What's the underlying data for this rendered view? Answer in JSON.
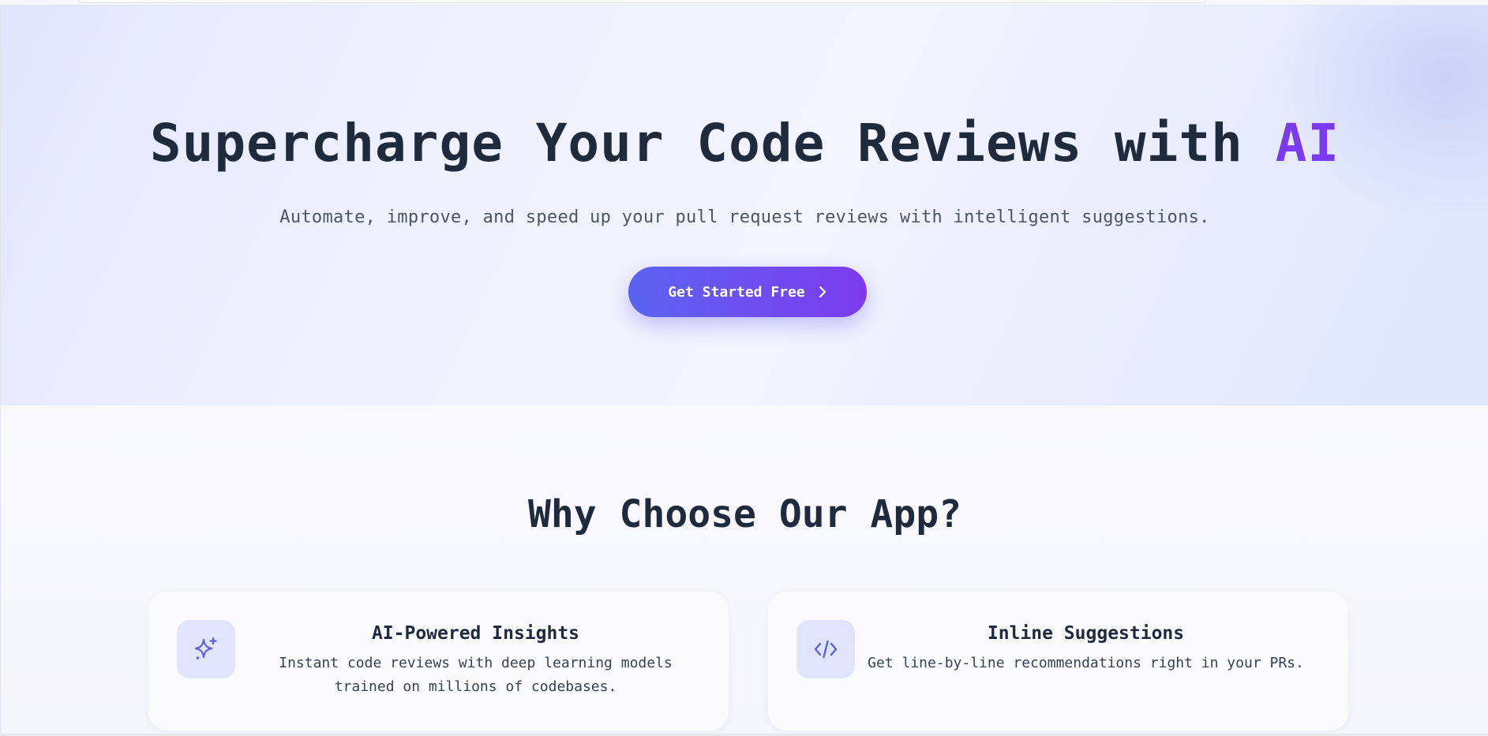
{
  "hero": {
    "title_main": "Supercharge Your Code Reviews with ",
    "title_accent": "AI",
    "subtitle": "Automate, improve, and speed up your pull request reviews with intelligent suggestions.",
    "cta_label": "Get Started Free",
    "cta_icon": "chevron-right-icon"
  },
  "features": {
    "title": "Why Choose Our App?",
    "cards": [
      {
        "icon": "sparkles-icon",
        "title": "AI-Powered Insights",
        "description": "Instant code reviews with deep learning models trained on millions of codebases."
      },
      {
        "icon": "code-icon",
        "title": "Inline Suggestions",
        "description": "Get line-by-line recommendations right in your PRs."
      }
    ]
  },
  "colors": {
    "accent": "#7c3aed",
    "button_gradient_start": "#5b63f0",
    "button_gradient_end": "#7c3aed",
    "icon_color": "#5b63d6",
    "icon_bg": "#e0e4fc",
    "text_dark": "#1f2a3d"
  }
}
